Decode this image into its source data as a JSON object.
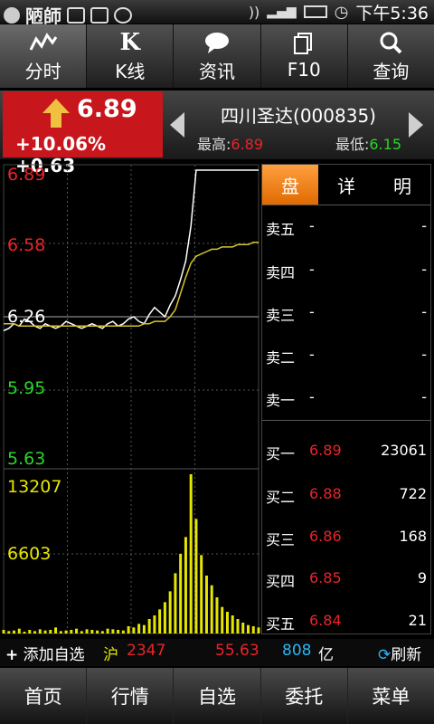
{
  "statusbar": {
    "app_text": "陋師",
    "time": "下午5:36"
  },
  "topnav": [
    {
      "label": "分时",
      "icon": "intraday-chart-icon"
    },
    {
      "label": "K线",
      "icon": "k-icon",
      "glyph": "K"
    },
    {
      "label": "资讯",
      "icon": "speech-bubble-icon"
    },
    {
      "label": "F10",
      "icon": "document-icon"
    },
    {
      "label": "查询",
      "icon": "search-icon"
    }
  ],
  "quote": {
    "price": "6.89",
    "change_pct": "+10.06%",
    "change": "+0.63",
    "name": "四川圣达(000835)",
    "high_label": "最高:",
    "high": "6.89",
    "low_label": "最低:",
    "low": "6.15"
  },
  "chart": {
    "price_labels": [
      {
        "text": "6.89",
        "color": "#e8242a"
      },
      {
        "text": "6.58",
        "color": "#e8242a"
      },
      {
        "text": "6.26",
        "color": "#ffffff"
      },
      {
        "text": "5.95",
        "color": "#28d628"
      },
      {
        "text": "5.63",
        "color": "#28d628"
      }
    ],
    "volume_labels": [
      {
        "text": "13207",
        "color": "#e6e600"
      },
      {
        "text": "6603",
        "color": "#e6e600"
      }
    ]
  },
  "chart_data": {
    "type": "line",
    "ylim": [
      5.63,
      6.89
    ],
    "prev_close": 6.26,
    "price_series": [
      6.2,
      6.21,
      6.23,
      6.22,
      6.25,
      6.24,
      6.22,
      6.21,
      6.23,
      6.22,
      6.21,
      6.22,
      6.24,
      6.23,
      6.22,
      6.21,
      6.22,
      6.23,
      6.22,
      6.21,
      6.23,
      6.24,
      6.22,
      6.23,
      6.25,
      6.26,
      6.24,
      6.23,
      6.27,
      6.3,
      6.28,
      6.26,
      6.31,
      6.35,
      6.42,
      6.5,
      6.65,
      6.89,
      6.89,
      6.89,
      6.89,
      6.89,
      6.89,
      6.89,
      6.89,
      6.89,
      6.89,
      6.89,
      6.89,
      6.89
    ],
    "avg_series": [
      6.23,
      6.23,
      6.23,
      6.22,
      6.22,
      6.22,
      6.22,
      6.22,
      6.22,
      6.22,
      6.22,
      6.22,
      6.22,
      6.22,
      6.22,
      6.22,
      6.22,
      6.22,
      6.22,
      6.22,
      6.22,
      6.22,
      6.22,
      6.22,
      6.22,
      6.22,
      6.22,
      6.23,
      6.23,
      6.24,
      6.24,
      6.24,
      6.26,
      6.29,
      6.36,
      6.43,
      6.49,
      6.52,
      6.53,
      6.54,
      6.55,
      6.55,
      6.56,
      6.56,
      6.56,
      6.57,
      6.57,
      6.57,
      6.58,
      6.58
    ],
    "volume_max": 13207,
    "volumes": [
      300,
      200,
      250,
      400,
      150,
      300,
      200,
      350,
      250,
      300,
      500,
      200,
      250,
      300,
      400,
      200,
      350,
      300,
      250,
      200,
      400,
      350,
      300,
      250,
      600,
      500,
      800,
      700,
      1200,
      1500,
      2000,
      2600,
      3500,
      5000,
      6603,
      8000,
      13207,
      9500,
      6500,
      4800,
      4000,
      3000,
      2200,
      1800,
      1500,
      1200,
      900,
      700,
      600,
      500
    ]
  },
  "book": {
    "tabs": [
      "盘",
      "详",
      "明"
    ],
    "asks": [
      {
        "label": "卖五",
        "price": "-",
        "vol": "-"
      },
      {
        "label": "卖四",
        "price": "-",
        "vol": "-"
      },
      {
        "label": "卖三",
        "price": "-",
        "vol": "-"
      },
      {
        "label": "卖二",
        "price": "-",
        "vol": "-"
      },
      {
        "label": "卖一",
        "price": "-",
        "vol": "-"
      }
    ],
    "bids": [
      {
        "label": "买一",
        "price": "6.89",
        "vol": "23061"
      },
      {
        "label": "买二",
        "price": "6.88",
        "vol": "722"
      },
      {
        "label": "买三",
        "price": "6.86",
        "vol": "168"
      },
      {
        "label": "买四",
        "price": "6.85",
        "vol": "9"
      },
      {
        "label": "买五",
        "price": "6.84",
        "vol": "21"
      }
    ]
  },
  "infobar": {
    "add_fav": "添加自选",
    "market": "沪",
    "index": "2347",
    "change": "55.63",
    "turnover": "808",
    "unit": "亿",
    "refresh": "刷新"
  },
  "bottomnav": [
    "首页",
    "行情",
    "自选",
    "委托",
    "菜单"
  ],
  "colors": {
    "up": "#e8242a",
    "down": "#28d628",
    "accent": "#f08a1e",
    "volume": "#e6e600"
  }
}
